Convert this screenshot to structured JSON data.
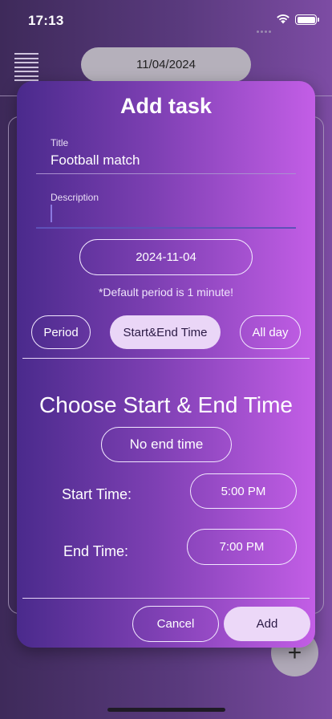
{
  "status_bar": {
    "time": "17:13"
  },
  "background": {
    "date": "11/04/2024",
    "fab_label": "+"
  },
  "modal": {
    "title": "Add task",
    "title_field": {
      "label": "Title",
      "value": "Football match"
    },
    "description_field": {
      "label": "Description",
      "value": ""
    },
    "date_button": "2024-11-04",
    "note": "*Default period is 1 minute!",
    "modes": [
      {
        "label": "Period",
        "selected": false
      },
      {
        "label": "Start&End Time",
        "selected": true
      },
      {
        "label": "All day",
        "selected": false
      }
    ],
    "section_title": "Choose Start & End Time",
    "no_end_time_button": "No end time",
    "start_time": {
      "label": "Start Time:",
      "value": "5:00 PM"
    },
    "end_time": {
      "label": "End Time:",
      "value": "7:00 PM"
    },
    "cancel_label": "Cancel",
    "add_label": "Add"
  },
  "colors": {
    "accent_selected": "#ead6f7",
    "modal_gradient_start": "#4a2a8c",
    "modal_gradient_end": "#c35ee6"
  }
}
